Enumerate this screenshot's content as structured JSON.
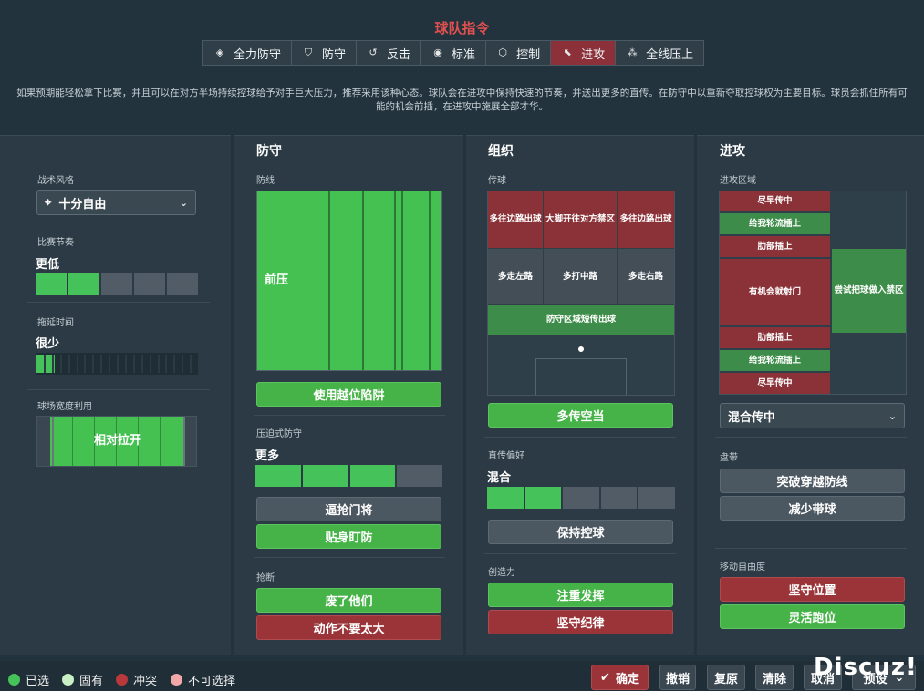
{
  "header": {
    "title": "球队指令",
    "modes": [
      {
        "label": "全力防守",
        "icon": "shield-heart-icon"
      },
      {
        "label": "防守",
        "icon": "shield-icon"
      },
      {
        "label": "反击",
        "icon": "counter-arrow-icon"
      },
      {
        "label": "标准",
        "icon": "balance-icon"
      },
      {
        "label": "控制",
        "icon": "cube-icon"
      },
      {
        "label": "进攻",
        "icon": "attack-arrow-icon",
        "active": true
      },
      {
        "label": "全线压上",
        "icon": "all-out-icon"
      }
    ],
    "description": "如果预期能轻松拿下比赛，并且可以在对方半场持续控球给予对手巨大压力，推荐采用该种心态。球队会在进攻中保持快速的节奏，并送出更多的直传。在防守中以重新夺取控球权为主要目标。球员会抓住所有可能的机会前插，在进攻中施展全部才华。"
  },
  "general": {
    "style_label": "战术风格",
    "style_value": "十分自由",
    "tempo_label": "比赛节奏",
    "tempo_value": "更低",
    "tempo_level": 2,
    "tempo_steps": 5,
    "time_wasting_label": "拖延时间",
    "time_wasting_value": "很少",
    "time_wasting_level": 0.12,
    "width_label": "球场宽度利用",
    "width_value": "相对拉开"
  },
  "defence": {
    "title": "防守",
    "line_label": "防线",
    "line_value": "前压",
    "offside_button": "使用越位陷阱",
    "press_label": "压迫式防守",
    "press_value": "更多",
    "press_level": 0.75,
    "buttons": [
      "逼抢门将",
      "贴身盯防"
    ],
    "tackle_label": "抢断",
    "tackle_buttons": [
      "废了他们",
      "动作不要太大"
    ]
  },
  "organisation": {
    "title": "组织",
    "passing_label": "传球",
    "zones_top": [
      "多往边路出球",
      "大脚开往对方禁区",
      "多往边路出球"
    ],
    "zones_mid": [
      "多走左路",
      "多打中路",
      "多走右路"
    ],
    "zone_bottom": "防守区域短传出球",
    "passing_button": "多传空当",
    "directness_label": "直传偏好",
    "directness_value": "混合",
    "directness_level": 0.5,
    "keep_ball_button": "保持控球",
    "creativity_label": "创造力",
    "creativity_buttons": [
      "注重发挥",
      "坚守纪律"
    ]
  },
  "attack": {
    "title": "进攻",
    "area_label": "进攻区域",
    "zones": [
      "尽早传中",
      "给我轮流插上",
      "肋部插上",
      "有机会就射门",
      "肋部插上",
      "给我轮流插上",
      "尽早传中"
    ],
    "box_zone": "尝试把球做入禁区",
    "crossing_value": "混合传中",
    "dribble_label": "盘带",
    "dribble_buttons": [
      "突破穿越防线",
      "减少带球"
    ],
    "freedom_label": "移动自由度",
    "freedom_buttons": [
      "坚守位置",
      "灵活跑位"
    ]
  },
  "footer": {
    "legend": [
      {
        "label": "已选",
        "color": "#46c25a"
      },
      {
        "label": "固有",
        "color": "#c9efc4"
      },
      {
        "label": "冲突",
        "color": "#b8383c"
      },
      {
        "label": "不可选择",
        "color": "#f2a8a8"
      }
    ],
    "confirm": "确定",
    "undo": "撤销",
    "restore": "复原",
    "clear": "清除",
    "cancel": "取消",
    "preset": "预设",
    "watermark": "Discuz!"
  }
}
